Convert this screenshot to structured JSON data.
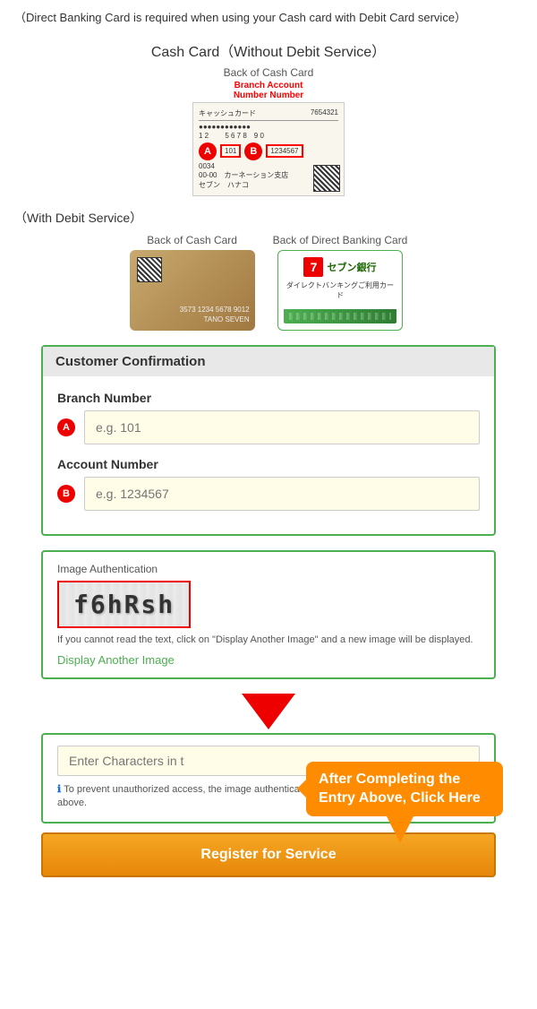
{
  "top_note": "（Direct Banking Card is required when using your Cash card with Debit Card service）",
  "cash_card_section": {
    "title": "Cash Card（Without Debit Service）",
    "card_back_label": "Back of Cash Card",
    "red_label": "Branch Account\nNumber Number",
    "card_numbers_line1": "0034  101  1234567",
    "card_numbers_line2": "00-00  カーネーション支店",
    "card_numbers_line3": "セブン　ハナコ"
  },
  "with_debit": {
    "title": "（With Debit Service）",
    "left_label": "Back of Cash Card",
    "right_label": "Back of Direct Banking Card",
    "cash_card_numbers": "3573 1234 5678 9012\nTANO SEVEN",
    "direct_bank_name": "セブン銀行",
    "direct_card_text": "ダイレクトバンキングご利用カード"
  },
  "confirmation": {
    "header": "Customer Confirmation",
    "branch_label": "Branch Number",
    "branch_placeholder": "e.g. 101",
    "account_label": "Account Number",
    "account_placeholder": "e.g. 1234567",
    "badge_a": "A",
    "badge_b": "B"
  },
  "auth": {
    "label": "Image Authentication",
    "captcha_text": "f6hRsh",
    "help_text": "If you cannot read the text, click on \"Display Another Image\" and a new image will be displayed.",
    "display_another": "Display Another Image"
  },
  "enter_section": {
    "input_placeholder": "Enter Characters in t",
    "prevent_text": "To prevent unauthorized access, the image authentication code will be displayed in the image above.",
    "callout_text": "After Completing the Entry Above, Click Here"
  },
  "register_button": "Register for Service"
}
